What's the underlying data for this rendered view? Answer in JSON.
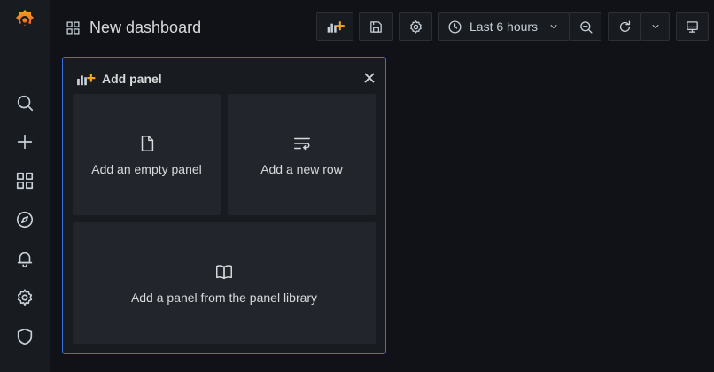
{
  "sidebar": {
    "logo": "grafana-logo",
    "items": [
      {
        "icon": "search-icon"
      },
      {
        "icon": "plus-icon"
      },
      {
        "icon": "dashboards-icon"
      },
      {
        "icon": "compass-icon"
      },
      {
        "icon": "bell-icon"
      },
      {
        "icon": "gear-icon"
      },
      {
        "icon": "shield-icon"
      }
    ]
  },
  "header": {
    "title": "New dashboard",
    "time_range": "Last 6 hours"
  },
  "panel": {
    "title": "Add panel",
    "cards": [
      {
        "label": "Add an empty panel",
        "icon": "file-icon"
      },
      {
        "label": "Add a new row",
        "icon": "row-icon"
      },
      {
        "label": "Add a panel from the panel library",
        "icon": "book-icon"
      }
    ]
  },
  "colors": {
    "background": "#111217",
    "panel_border": "#3871dc",
    "accent": "#f5a623"
  }
}
